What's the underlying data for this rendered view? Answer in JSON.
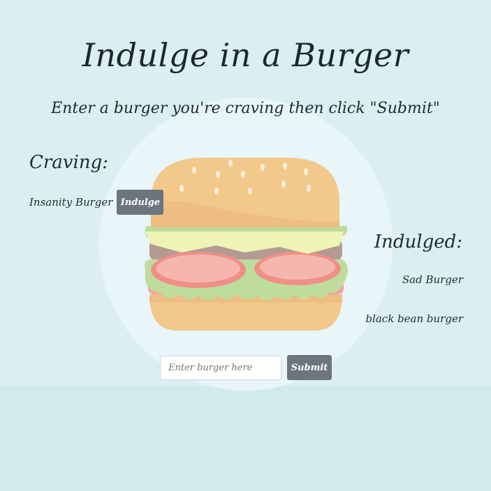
{
  "header": {
    "title": "Indulge in a Burger",
    "subtitle": "Enter a burger you're craving then click \"Submit\""
  },
  "craving": {
    "heading": "Craving:",
    "items": [
      {
        "name": "Insanity Burger",
        "button_label": "Indulge"
      }
    ]
  },
  "indulged": {
    "heading": "Indulged:",
    "items": [
      "Sad Burger",
      "black bean burger"
    ]
  },
  "form": {
    "input_value": "",
    "input_placeholder": "Enter burger here",
    "submit_label": "Submit"
  },
  "colors": {
    "page_background": "#dbeff3",
    "lower_background": "#d1ebea",
    "circle": "#e8f5f9",
    "button": "#6c757d"
  },
  "illustration": "burger-illustration"
}
